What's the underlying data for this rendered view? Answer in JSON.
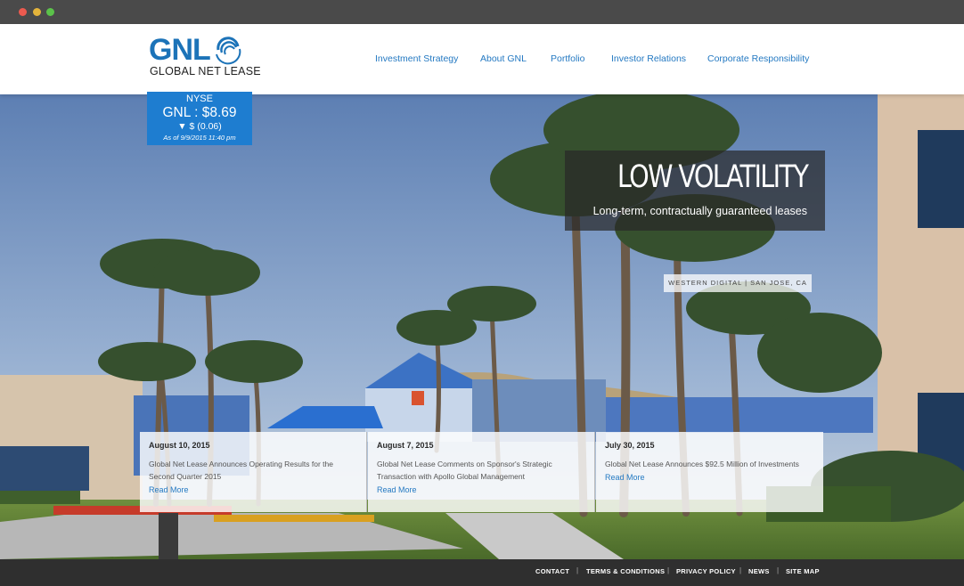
{
  "brand": {
    "logo_text": "GNL",
    "logo_subtitle": "GLOBAL NET LEASE"
  },
  "nav": {
    "items": [
      {
        "label": "Investment Strategy"
      },
      {
        "label": "About GNL"
      },
      {
        "label": "Portfolio"
      },
      {
        "label": "Investor Relations"
      },
      {
        "label": "Corporate Responsibility"
      }
    ]
  },
  "ticker": {
    "exchange": "NYSE",
    "price": "GNL : $8.69",
    "change": "▼ $ (0.06)",
    "as_of": "As of 9/9/2015 11:40 pm"
  },
  "hero": {
    "headline": "LOW VOLATILITY",
    "subheadline": "Long-term, contractually guaranteed leases",
    "photo_caption": "WESTERN DIGITAL | SAN JOSE, CA"
  },
  "news": [
    {
      "date": "August 10, 2015",
      "title": "Global Net Lease Announces Operating Results for the Second Quarter 2015",
      "link": "Read More"
    },
    {
      "date": "August 7, 2015",
      "title": "Global Net Lease Comments on Sponsor's Strategic Transaction with Apollo Global Management",
      "link": "Read More"
    },
    {
      "date": "July 30, 2015",
      "title": "Global Net Lease Announces $92.5 Million of Investments",
      "link": "Read More"
    }
  ],
  "footer": {
    "links": [
      {
        "label": "CONTACT"
      },
      {
        "label": "TERMS & CONDITIONS"
      },
      {
        "label": "PRIVACY POLICY"
      },
      {
        "label": "NEWS"
      },
      {
        "label": "SITE MAP"
      }
    ],
    "separator": "|"
  },
  "colors": {
    "brand_blue": "#1c73b8",
    "ticker_blue": "#1e7dd0",
    "link_blue": "#2479c2",
    "footer_bg": "#2f2f2f"
  },
  "icons": [
    "window-close-dot",
    "window-minimize-dot",
    "window-maximize-dot",
    "logo-swirl-icon"
  ]
}
